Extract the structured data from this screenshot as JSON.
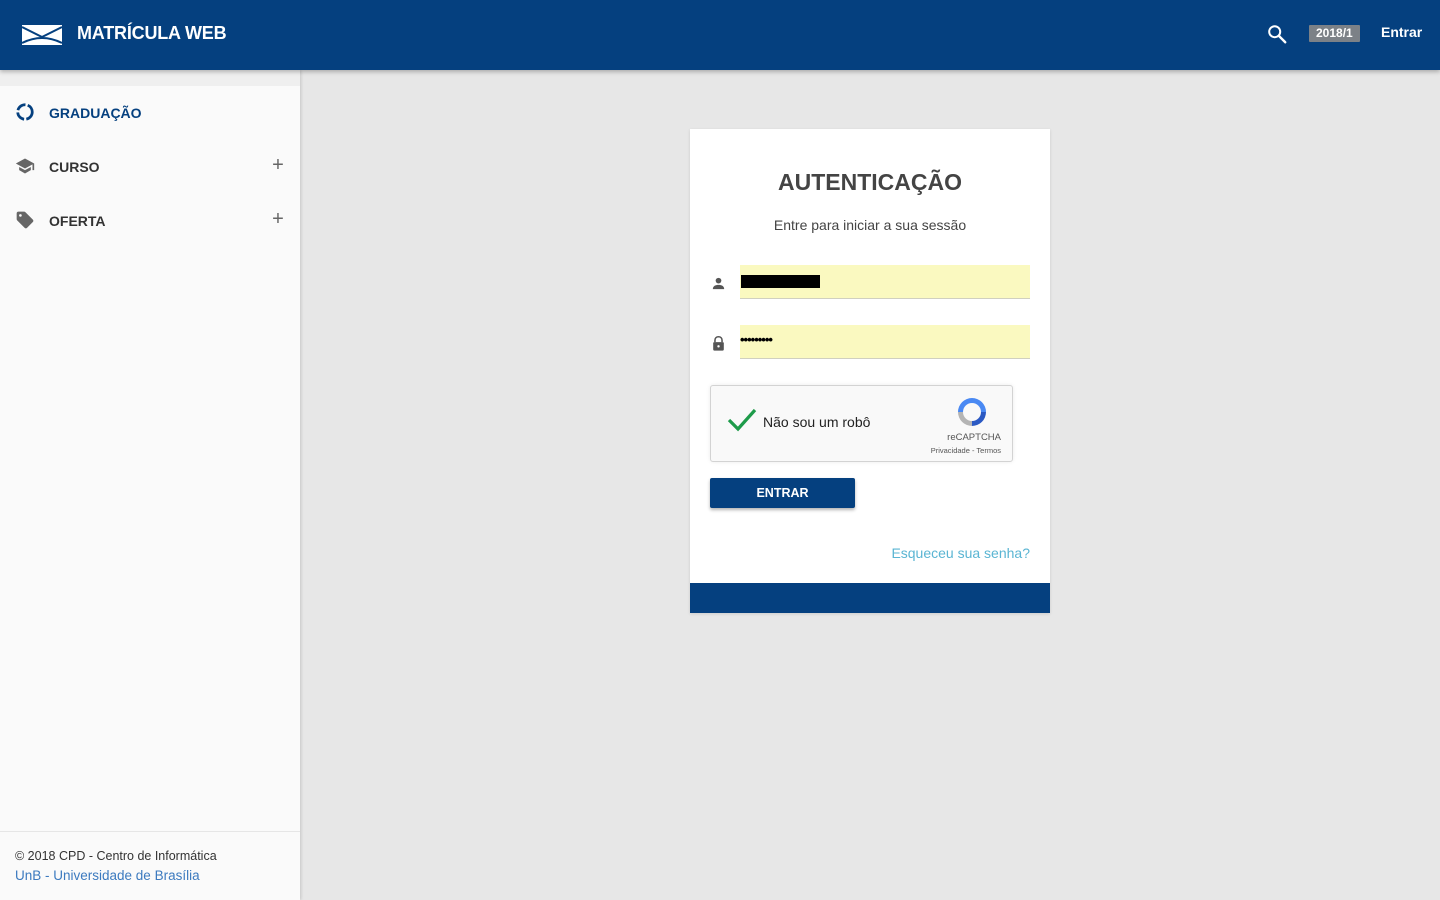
{
  "header": {
    "app_title": "MATRÍCULA WEB",
    "semester": "2018/1",
    "login_label": "Entrar",
    "icons": {
      "logo": "unb-logo-icon",
      "search": "search-icon"
    },
    "color": "#05407f"
  },
  "sidebar": {
    "items": [
      {
        "label": "GRADUAÇÃO",
        "icon": "graduation-circle-icon",
        "expandable": false,
        "active": true
      },
      {
        "label": "CURSO",
        "icon": "mortarboard-icon",
        "expandable": true
      },
      {
        "label": "OFERTA",
        "icon": "tag-icon",
        "expandable": true
      }
    ],
    "expand_symbol": "+"
  },
  "footer": {
    "copyright": "© 2018 CPD - Centro de Informática",
    "university_link": "UnB - Universidade de Brasília"
  },
  "login": {
    "title": "AUTENTICAÇÃO",
    "subtitle": "Entre para iniciar a sua sessão",
    "password_value": "•••••••••",
    "captcha": {
      "label": "Não sou um robô",
      "brand": "reCAPTCHA",
      "links": "Privacidade - Termos",
      "checked": true
    },
    "submit_label": "ENTRAR",
    "forgot_label": "Esqueceu sua senha?"
  }
}
